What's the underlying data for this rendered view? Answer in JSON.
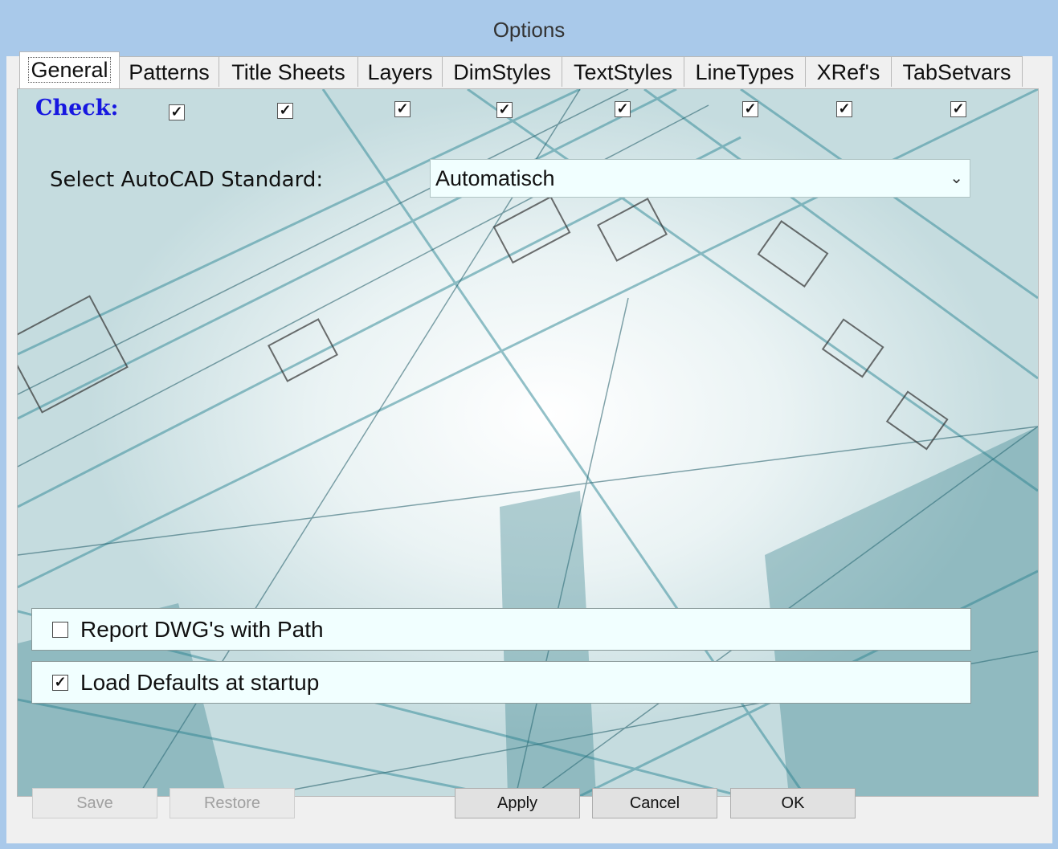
{
  "window": {
    "title": "Options"
  },
  "tabs": [
    {
      "label": "General",
      "selected": true
    },
    {
      "label": "Patterns"
    },
    {
      "label": "Title Sheets"
    },
    {
      "label": "Layers"
    },
    {
      "label": "DimStyles"
    },
    {
      "label": "TextStyles"
    },
    {
      "label": "LineTypes"
    },
    {
      "label": "XRef's"
    },
    {
      "label": "TabSetvars"
    }
  ],
  "general": {
    "check_label": "Check:",
    "check_boxes": [
      true,
      true,
      true,
      true,
      true,
      true,
      true,
      true
    ],
    "standard_label": "Select AutoCAD Standard:",
    "standard_value": "Automatisch",
    "report_dwg_label": "Report DWG's with Path",
    "report_dwg_checked": false,
    "load_defaults_label": "Load Defaults at startup",
    "load_defaults_checked": true
  },
  "buttons": {
    "save": "Save",
    "restore": "Restore",
    "apply": "Apply",
    "cancel": "Cancel",
    "ok": "OK"
  },
  "colors": {
    "accent_text": "#1717e0",
    "title_bar": "#a9c9ea",
    "field_bg": "#f1ffff"
  },
  "icons": {
    "check": "✓",
    "dropdown": "chevron-down-icon"
  }
}
